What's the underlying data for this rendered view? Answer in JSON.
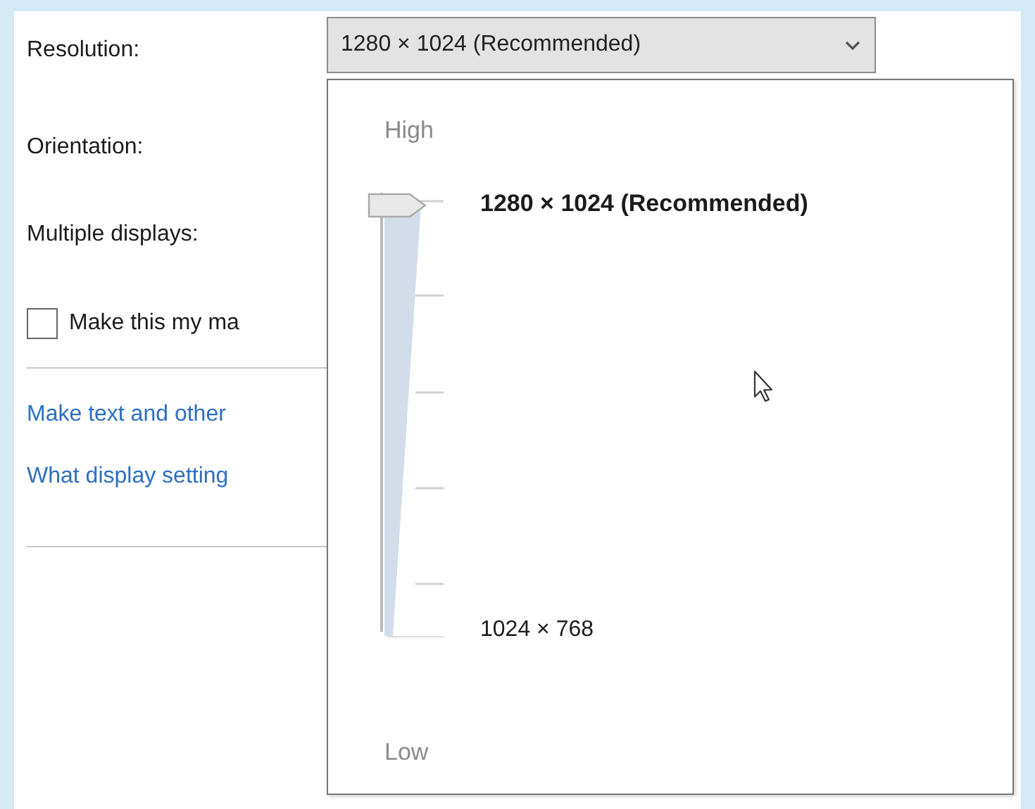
{
  "settings": [
    {
      "label": "Resolution:"
    },
    {
      "label": "Orientation:"
    },
    {
      "label": "Multiple displays:"
    }
  ],
  "resolution_dropdown": {
    "value": "1280 × 1024 (Recommended)",
    "expanded": true
  },
  "main_display_checkbox": {
    "label": "Make this my ma",
    "checked": false
  },
  "links": [
    "Make text and other",
    "What display setting"
  ],
  "resolution_popup": {
    "high_label": "High",
    "low_label": "Low",
    "level": 1,
    "top_option": "1280 × 1024 (Recommended)",
    "bottom_option": "1024 × 768"
  }
}
